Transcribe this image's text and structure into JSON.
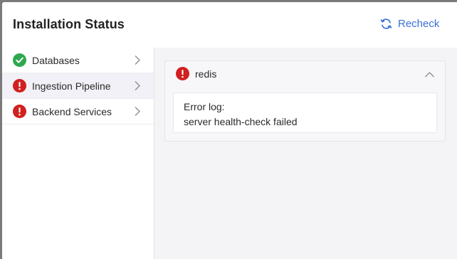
{
  "dialog": {
    "title": "Installation Status",
    "recheck_label": "Recheck",
    "recheck_icon": "refresh-icon"
  },
  "sidebar": {
    "items": [
      {
        "label": "Databases",
        "status": "success",
        "status_icon": "check-circle-icon",
        "chevron_icon": "chevron-right-icon",
        "active": false
      },
      {
        "label": "Ingestion Pipeline",
        "status": "error",
        "status_icon": "error-circle-icon",
        "chevron_icon": "chevron-right-icon",
        "active": true
      },
      {
        "label": "Backend Services",
        "status": "error",
        "status_icon": "error-circle-icon",
        "chevron_icon": "chevron-right-icon",
        "active": false
      }
    ]
  },
  "detail": {
    "service": {
      "name": "redis",
      "status": "error",
      "status_icon": "error-circle-icon",
      "toggle_icon": "chevron-up-icon",
      "expanded": true
    },
    "log": {
      "heading": "Error log:",
      "message": "server health-check failed"
    }
  },
  "colors": {
    "accent": "#3a6fd8",
    "success": "#2fa84f",
    "error": "#d21f1f",
    "backdrop": "#7a7a7a"
  }
}
